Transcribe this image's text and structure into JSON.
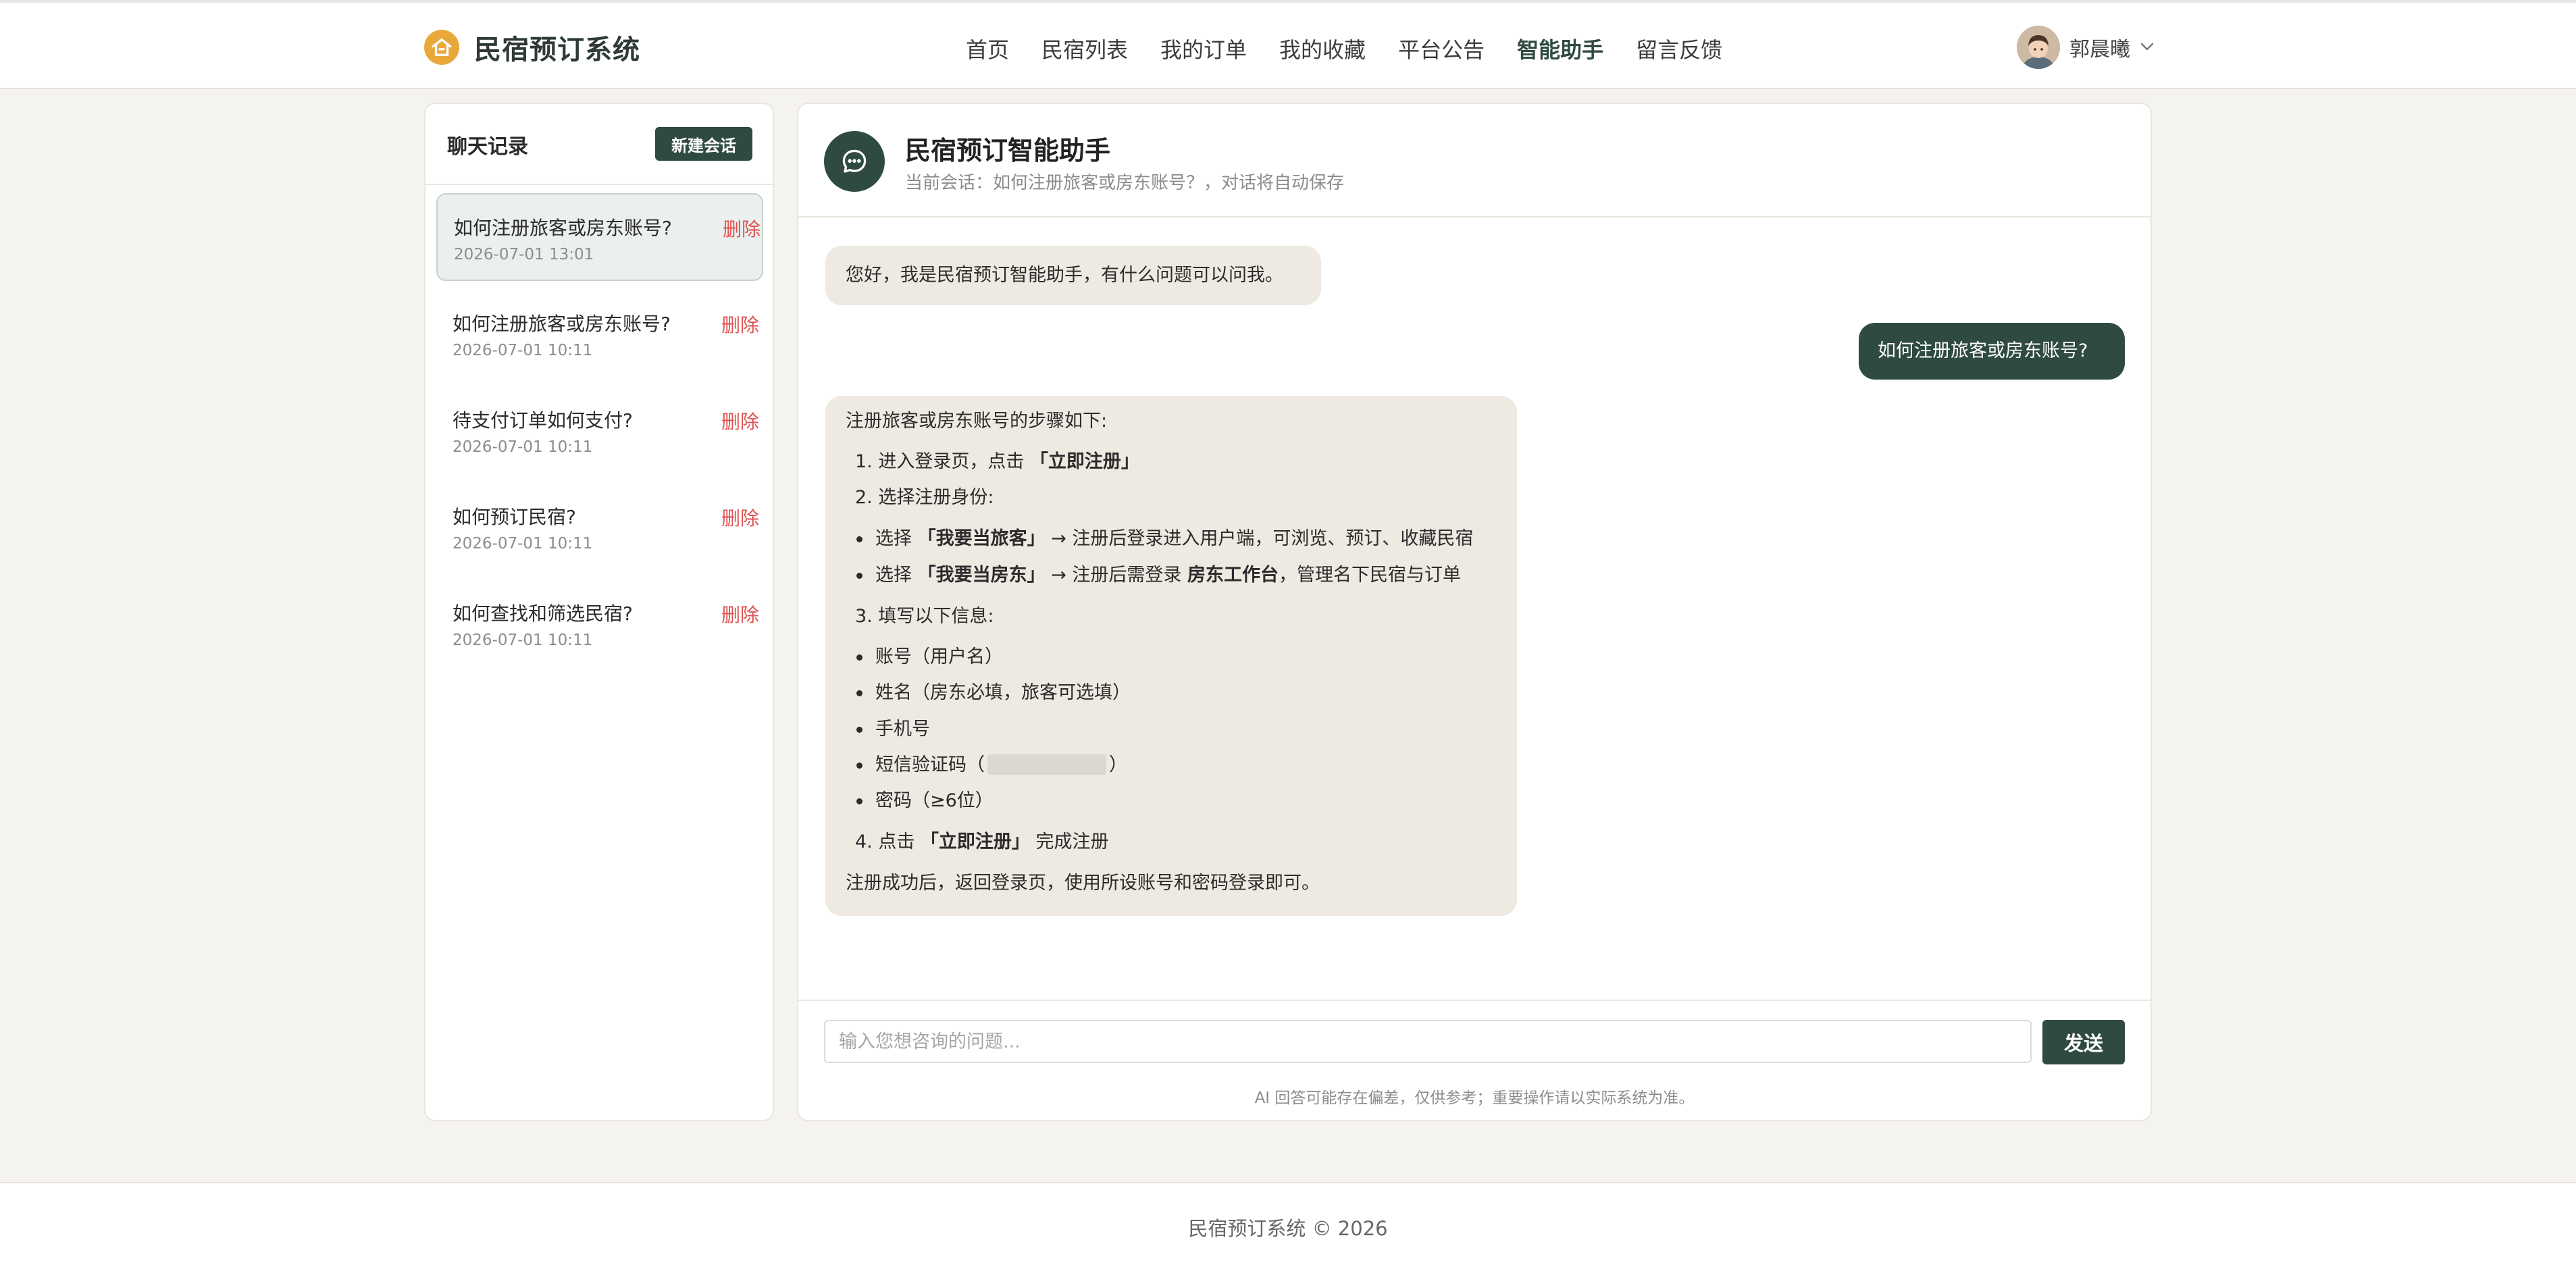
{
  "brand": {
    "title": "民宿预订系统"
  },
  "nav": {
    "items": [
      {
        "label": "首页"
      },
      {
        "label": "民宿列表"
      },
      {
        "label": "我的订单"
      },
      {
        "label": "我的收藏"
      },
      {
        "label": "平台公告"
      },
      {
        "label": "智能助手"
      },
      {
        "label": "留言反馈"
      }
    ],
    "active": "智能助手"
  },
  "user": {
    "name": "郭晨曦"
  },
  "history": {
    "title": "聊天记录",
    "new_button": "新建会话",
    "delete_label": "删除",
    "items": [
      {
        "title": "如何注册旅客或房东账号?",
        "time": "2026-07-01 13:01"
      },
      {
        "title": "如何注册旅客或房东账号?",
        "time": "2026-07-01 10:11"
      },
      {
        "title": "待支付订单如何支付?",
        "time": "2026-07-01 10:11"
      },
      {
        "title": "如何预订民宿?",
        "time": "2026-07-01 10:11"
      },
      {
        "title": "如何查找和筛选民宿?",
        "time": "2026-07-01 10:11"
      }
    ]
  },
  "chat": {
    "title": "民宿预订智能助手",
    "subtitle": "当前会话：如何注册旅客或房东账号？，对话将自动保存",
    "messages": {
      "greeting": "您好，我是民宿预订智能助手，有什么问题可以问我。",
      "question": "如何注册旅客或房东账号?",
      "answer": {
        "intro": "注册旅客或房东账号的步骤如下:",
        "step1_pre": "1. 进入登录页，点击",
        "step1_bold": "「立即注册」",
        "step2": "2. 选择注册身份:",
        "role1_pre": "选择",
        "role1_bold": "「我要当旅客」",
        "role1_post": "→ 注册后登录进入用户端，可浏览、预订、收藏民宿",
        "role2_pre": "选择",
        "role2_bold": "「我要当房东」",
        "role2_mid": "→ 注册后需登录",
        "role2_bold2": "房东工作台",
        "role2_post": "，管理名下民宿与订单",
        "step3": "3. 填写以下信息:",
        "field1": "账号（用户名）",
        "field2": "姓名（房东必填，旅客可选填）",
        "field3": "手机号",
        "field4_pre": "短信验证码（",
        "field4_post": "）",
        "field5": "密码（≥6位）",
        "step4_pre": "4. 点击",
        "step4_bold": "「立即注册」",
        "step4_post": "完成注册",
        "outro": "注册成功后，返回登录页，使用所设账号和密码登录即可。"
      }
    },
    "input": {
      "placeholder": "输入您想咨询的问题...",
      "value": ""
    },
    "send_label": "发送",
    "disclaimer": "AI 回答可能存在偏差，仅供参考；重要操作请以实际系统为准。"
  },
  "footer": {
    "text": "民宿预订系统 © 2026"
  },
  "colors": {
    "primary": "#2f4a42",
    "accent": "#e8a93a",
    "danger": "#e05151",
    "bot_bubble": "#eee9e1",
    "page_bg": "#f5f3ef"
  }
}
